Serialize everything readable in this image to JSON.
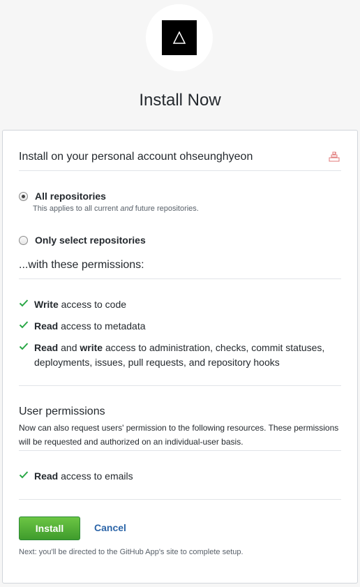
{
  "app": {
    "title": "Install Now",
    "logo_icon": "triangle-icon"
  },
  "account": {
    "label": "Install on your personal account ohseunghyeon",
    "avatar_icon": "user-avatar-icon"
  },
  "repositories": {
    "all_label": "All repositories",
    "all_note_prefix": "This applies to all current ",
    "all_note_emphasis": "and",
    "all_note_suffix": " future repositories.",
    "select_label": "Only select repositories",
    "selected": "all"
  },
  "permissions": {
    "heading": "...with these permissions:",
    "items": [
      {
        "strong": "Write",
        "rest": " access to code"
      },
      {
        "strong": "Read",
        "rest": " access to metadata"
      },
      {
        "strong": "Read",
        "middle": " and ",
        "strong2": "write",
        "rest": " access to administration, checks, commit statuses, deployments, issues, pull requests, and repository hooks"
      }
    ]
  },
  "user_permissions": {
    "title": "User permissions",
    "description": "Now can also request users' permission to the following resources. These permissions will be requested and authorized on an individual-user basis.",
    "items": [
      {
        "strong": "Read",
        "rest": " access to emails"
      }
    ]
  },
  "actions": {
    "install_label": "Install",
    "cancel_label": "Cancel",
    "next_note": "Next: you'll be directed to the GitHub App's site to complete setup."
  },
  "colors": {
    "accent_green": "#6cc644",
    "link_blue": "#2c65a8",
    "check_green": "#28a745"
  }
}
